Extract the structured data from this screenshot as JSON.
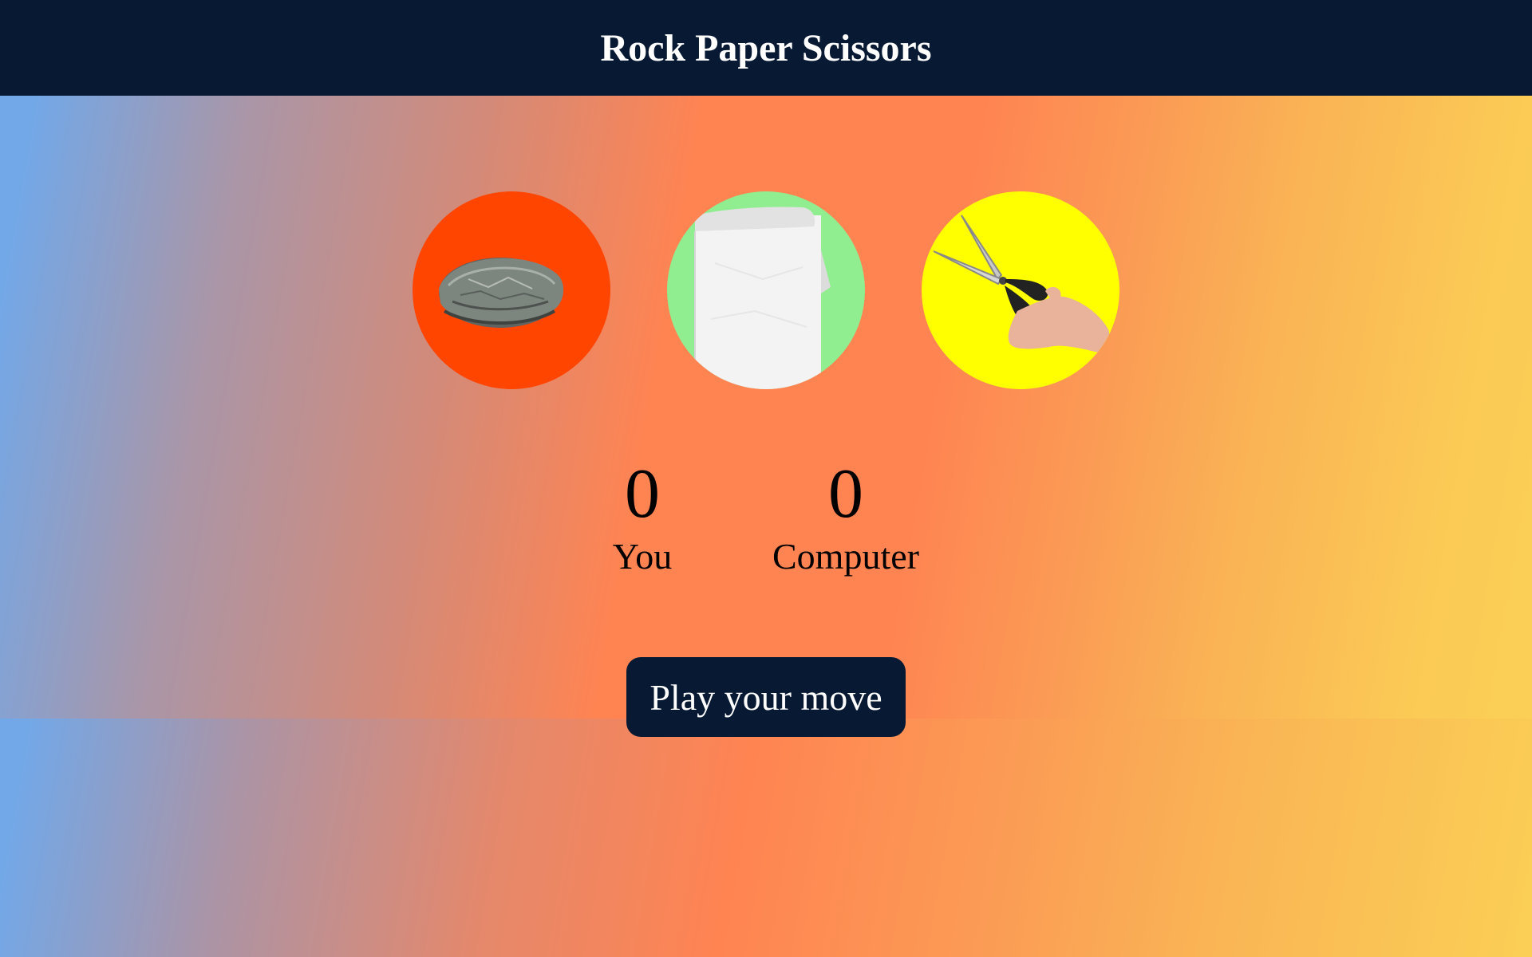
{
  "header": {
    "title": "Rock Paper Scissors"
  },
  "choices": [
    {
      "id": "rock",
      "icon": "rock-icon",
      "color": "#ff4500"
    },
    {
      "id": "paper",
      "icon": "paper-icon",
      "color": "#90ee90"
    },
    {
      "id": "scissors",
      "icon": "scissors-icon",
      "color": "#ffff00"
    }
  ],
  "scores": {
    "you": {
      "value": "0",
      "label": "You"
    },
    "computer": {
      "value": "0",
      "label": "Computer"
    }
  },
  "message": {
    "label": "Play your move"
  },
  "colors": {
    "header_bg": "#081a33",
    "button_bg": "#081a33"
  }
}
